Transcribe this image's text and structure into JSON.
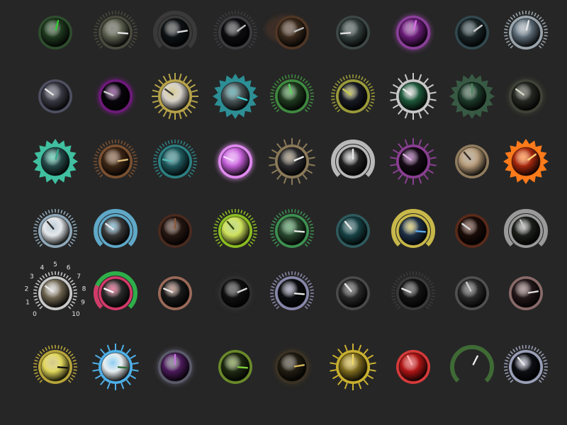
{
  "knobs": [
    {
      "id": "k01",
      "style": "ring-lcd",
      "face": "#1f3a1f",
      "accent": "#33cc33",
      "rim": "#2e4d2e",
      "level": 0.55
    },
    {
      "id": "k02",
      "style": "tick-ring",
      "face": "#5d6150",
      "accent": "#e8e8e8",
      "rim": "#4a4a3e",
      "level": 0.85
    },
    {
      "id": "k03",
      "style": "arc",
      "face": "#0e1315",
      "accent": "#dcdcdc",
      "rim": "#3a3a3a",
      "level": 0.8
    },
    {
      "id": "k04",
      "style": "tick-ring",
      "face": "#0d0d10",
      "accent": "#c0c0c0",
      "rim": "#3c3c40",
      "level": 0.7
    },
    {
      "id": "k05",
      "style": "shadow",
      "face": "#3a2a1c",
      "accent": "#bfbfbf",
      "rim": "#4f3625",
      "level": 0.75
    },
    {
      "id": "k06",
      "style": "dome",
      "face": "#34403d",
      "accent": "#e0e0e0",
      "rim": "#3d4846",
      "level": 0.15
    },
    {
      "id": "k07",
      "style": "glow",
      "face": "#6a1b78",
      "accent": "#d96fe8",
      "rim": "#8b3f9a",
      "level": 0.55
    },
    {
      "id": "k08",
      "style": "plain",
      "face": "#1a2528",
      "accent": "#d0d0d0",
      "rim": "#31484e",
      "level": 0.7
    },
    {
      "id": "k09",
      "style": "tick-ring",
      "face": "#5c6c78",
      "accent": "#e8e8e8",
      "rim": "#9aa5ad",
      "level": 0.55
    },
    {
      "id": "k10",
      "style": "plain",
      "face": "#3a3a45",
      "accent": "#e8e8e8",
      "rim": "#4e4f60",
      "level": 0.3
    },
    {
      "id": "k11",
      "style": "glow",
      "face": "#08050b",
      "accent": "#cfcfcf",
      "rim": "#6d1a7a",
      "level": 0.25
    },
    {
      "id": "k12",
      "style": "star",
      "face": "#d4cfc7",
      "accent": "#3a3a3a",
      "rim": "#b6a34a",
      "level": 0.3
    },
    {
      "id": "k13",
      "style": "gear",
      "face": "#4a5658",
      "accent": "#3ed3d3",
      "rim": "#2d8f95",
      "level": 0.9
    },
    {
      "id": "k14",
      "style": "tick-ring",
      "face": "#1f3a1f",
      "accent": "#5bd35b",
      "rim": "#3f8a3f",
      "level": 0.45
    },
    {
      "id": "k15",
      "style": "tick-ring",
      "face": "#191b25",
      "accent": "#c8c84a",
      "rim": "#9b9b3a",
      "level": 0.3
    },
    {
      "id": "k16",
      "style": "spikes",
      "face": "#1e5a3b",
      "accent": "#e8e8e8",
      "rim": "#c9c9c9",
      "level": 0.3
    },
    {
      "id": "k17",
      "style": "gear",
      "face": "#1d3a2a",
      "accent": "#4e8a5e",
      "rim": "#385a44",
      "level": 0.5
    },
    {
      "id": "k18",
      "style": "glow",
      "face": "#262822",
      "accent": "#d9d9c8",
      "rim": "#3f4236",
      "level": 0.3
    },
    {
      "id": "k19",
      "style": "gear",
      "face": "#274a4a",
      "accent": "#2fa88c",
      "rim": "#40c0a0",
      "level": 0.55
    },
    {
      "id": "k20",
      "style": "tick-ring",
      "face": "#3e2716",
      "accent": "#e0c07a",
      "rim": "#7a5030",
      "level": 0.8
    },
    {
      "id": "k21",
      "style": "tick-ring",
      "face": "#1f5a5e",
      "accent": "#57b8b8",
      "rim": "#2c7f82",
      "level": 0.2
    },
    {
      "id": "k22",
      "style": "glow",
      "face": "#c55fd9",
      "accent": "#f3d6ff",
      "rim": "#e08af0",
      "level": 0.25
    },
    {
      "id": "k23",
      "style": "spikes",
      "face": "#2b2b2e",
      "accent": "#f0f0f0",
      "rim": "#8b7a5a",
      "level": 0.75
    },
    {
      "id": "k24",
      "style": "arc",
      "face": "#202020",
      "accent": "#e8e8e8",
      "rim": "#b9b9b9",
      "level": 0.5
    },
    {
      "id": "k25",
      "style": "spikes",
      "face": "#150a16",
      "accent": "#d9b1e0",
      "rim": "#8a3f92",
      "level": 0.3
    },
    {
      "id": "k26",
      "style": "plain",
      "face": "#b59a78",
      "accent": "#3a2f25",
      "rim": "#8f7b5e",
      "level": 0.35
    },
    {
      "id": "k27",
      "style": "gear",
      "face": "#a5280f",
      "accent": "#ffd27a",
      "rim": "#ff7a1a",
      "level": 0.7
    },
    {
      "id": "k28",
      "style": "tick-ring",
      "face": "#e3e7ea",
      "accent": "#303030",
      "rim": "#8fa8b8",
      "level": 0.35
    },
    {
      "id": "k29",
      "style": "arc",
      "face": "#3a3a3a",
      "accent": "#e8e8e8",
      "rim": "#5fa8c8",
      "level": 0.3
    },
    {
      "id": "k30",
      "style": "plain",
      "face": "#261712",
      "accent": "#8a5a3a",
      "rim": "#4a2a1f",
      "level": 0.5
    },
    {
      "id": "k31",
      "style": "tick-ring",
      "face": "#cde05a",
      "accent": "#3b4a10",
      "rim": "#8bbd22",
      "level": 0.35
    },
    {
      "id": "k32",
      "style": "tick-ring",
      "face": "#2a4a30",
      "accent": "#e8e8e8",
      "rim": "#3d9150",
      "level": 0.85
    },
    {
      "id": "k33",
      "style": "dome",
      "face": "#174245",
      "accent": "#e8e8e8",
      "rim": "#2f5a5d",
      "level": 0.35
    },
    {
      "id": "k34",
      "style": "arc",
      "face": "#1e2f45",
      "accent": "#5aa8e8",
      "rim": "#c8b84a",
      "level": 0.85
    },
    {
      "id": "k35",
      "style": "plain",
      "face": "#1a0c08",
      "accent": "#d9d9d9",
      "rim": "#5a2a1a",
      "level": 0.3
    },
    {
      "id": "k36",
      "style": "arc",
      "face": "#1c1f1a",
      "accent": "#c8c8c8",
      "rim": "#9a9a9a",
      "level": 0.4
    },
    {
      "id": "k37",
      "style": "scale",
      "face": "#6f6551",
      "accent": "#e8e8e8",
      "rim": "#c9c9c9",
      "level": 0.3,
      "scale": [
        "0",
        "1",
        "2",
        "3",
        "4",
        "5",
        "6",
        "7",
        "8",
        "9",
        "10"
      ]
    },
    {
      "id": "k38",
      "style": "red-green",
      "face": "#2b2b2b",
      "accent": "#ffffff",
      "rim": "#d23a6a",
      "level": 0.25
    },
    {
      "id": "k39",
      "style": "plain",
      "face": "#1a1a1a",
      "accent": "#e8e8e8",
      "rim": "#9b6a5a",
      "level": 0.25
    },
    {
      "id": "k40",
      "style": "glow",
      "face": "#101010",
      "accent": "#dcdcdc",
      "rim": "#2f2f2f",
      "level": 0.75
    },
    {
      "id": "k41",
      "style": "tick-ring",
      "face": "#0c0d10",
      "accent": "#e8e8e8",
      "rim": "#8888aa",
      "level": 0.85
    },
    {
      "id": "k42",
      "style": "plain",
      "face": "#2a2a2a",
      "accent": "#e8e8e8",
      "rim": "#4a4a4a",
      "level": 0.35
    },
    {
      "id": "k43",
      "style": "tick-ring",
      "face": "#141414",
      "accent": "#e8e8e8",
      "rim": "#3a3a3a",
      "level": 0.25
    },
    {
      "id": "k44",
      "style": "plain",
      "face": "#2a2a2a",
      "accent": "#d0d0d0",
      "rim": "#505050",
      "level": 0.4
    },
    {
      "id": "k45",
      "style": "plain",
      "face": "#241719",
      "accent": "#dcdcdc",
      "rim": "#8a6a6a",
      "level": 0.8
    },
    {
      "id": "k46",
      "style": "tick-ring",
      "face": "#e0d65a",
      "accent": "#111111",
      "rim": "#b8a53a",
      "level": 0.85
    },
    {
      "id": "k47",
      "style": "spikes",
      "face": "#e8eef0",
      "accent": "#2d6a3a",
      "rim": "#4fb0e8",
      "level": 0.85
    },
    {
      "id": "k48",
      "style": "glow",
      "face": "#4b1a5a",
      "accent": "#c776e0",
      "rim": "#5a5a6a",
      "level": 0.5
    },
    {
      "id": "k49",
      "style": "plain",
      "face": "#1f2a12",
      "accent": "#7fcf3a",
      "rim": "#6a8a2a",
      "level": 0.85
    },
    {
      "id": "k50",
      "style": "glow",
      "face": "#221d12",
      "accent": "#d8bc5a",
      "rim": "#3a3224",
      "level": 0.8
    },
    {
      "id": "k51",
      "style": "spikes",
      "face": "#7e6b1e",
      "accent": "#f0d860",
      "rim": "#c9b030",
      "level": 0.5
    },
    {
      "id": "k52",
      "style": "plain",
      "face": "#b01515",
      "accent": "#ffb0b0",
      "rim": "#d73a3a",
      "level": 0.4
    },
    {
      "id": "k53",
      "style": "arc-open",
      "face": "#262626",
      "accent": "#e8e8e8",
      "rim": "#3f6a35",
      "level": 0.6
    },
    {
      "id": "k54",
      "style": "tick-ring",
      "face": "#0e0f14",
      "accent": "#e8e8e8",
      "rim": "#9aa0b8",
      "level": 0.35
    }
  ]
}
